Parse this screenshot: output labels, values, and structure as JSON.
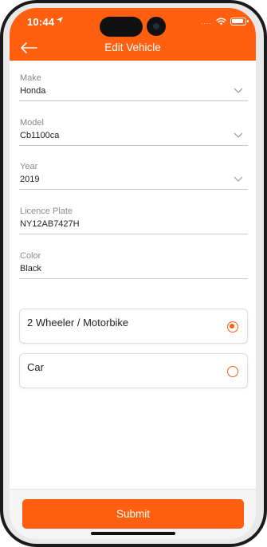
{
  "status_bar": {
    "time": "10:44",
    "signal": "....",
    "icons": [
      "location-arrow-icon",
      "wifi-icon",
      "battery-icon"
    ]
  },
  "header": {
    "title": "Edit Vehicle",
    "back_icon": "back-arrow-icon"
  },
  "form": {
    "make": {
      "label": "Make",
      "value": "Honda"
    },
    "model": {
      "label": "Model",
      "value": "Cb1100ca"
    },
    "year": {
      "label": "Year",
      "value": "2019"
    },
    "licence_plate": {
      "label": "Licence Plate",
      "value": "NY12AB7427H"
    },
    "color": {
      "label": "Color",
      "value": "Black"
    }
  },
  "vehicle_types": [
    {
      "label": "2 Wheeler / Motorbike",
      "selected": true
    },
    {
      "label": "Car",
      "selected": false
    }
  ],
  "footer": {
    "submit_label": "Submit"
  },
  "colors": {
    "accent": "#ff5f0e",
    "divider": "#c9c9c9",
    "label": "#8a8a8a",
    "text": "#222222"
  }
}
